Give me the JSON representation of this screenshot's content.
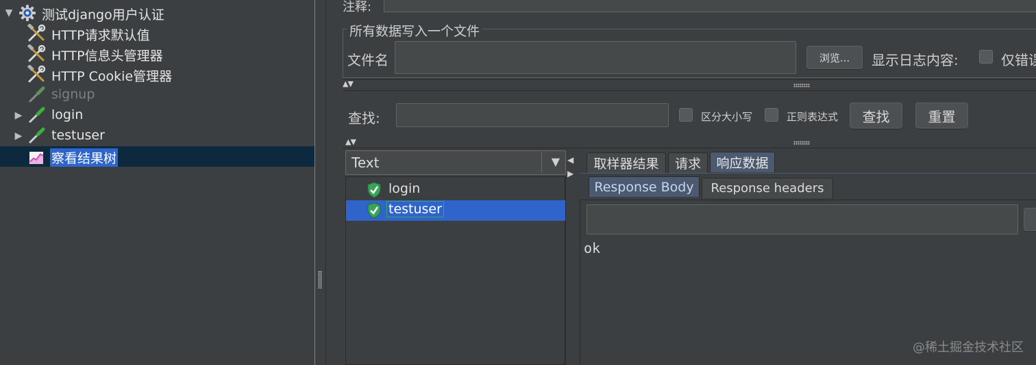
{
  "tree": {
    "items": [
      {
        "label": "测试django用户认证",
        "icon": "gear-icon",
        "expanded": true
      },
      {
        "label": "HTTP请求默认值",
        "icon": "wrench-hammer-icon"
      },
      {
        "label": "HTTP信息头管理器",
        "icon": "wrench-hammer-icon"
      },
      {
        "label": "HTTP Cookie管理器",
        "icon": "wrench-hammer-icon"
      },
      {
        "label": "signup",
        "icon": "pipette-icon",
        "disabled": true
      },
      {
        "label": "login",
        "icon": "pipette-icon",
        "collapsed": true
      },
      {
        "label": "testuser",
        "icon": "pipette-icon",
        "collapsed": true
      },
      {
        "label": "察看结果树",
        "icon": "chart-icon",
        "selected": true
      }
    ]
  },
  "header": {
    "comment_label": "注释:"
  },
  "file_section": {
    "title": "所有数据写入一个文件",
    "filename_label": "文件名",
    "filename_value": "",
    "browse_label": "浏览...",
    "log_display_label": "显示日志内容:",
    "errors_only_label": "仅错误"
  },
  "search": {
    "label": "查找:",
    "value": "",
    "case_sensitive_label": "区分大小写",
    "regex_label": "正则表达式",
    "find_button": "查找",
    "reset_button": "重置"
  },
  "results": {
    "renderer": "Text",
    "items": [
      {
        "label": "login",
        "status": "success"
      },
      {
        "label": "testuser",
        "status": "success",
        "selected": true
      }
    ]
  },
  "tabs": {
    "main": [
      "取样器结果",
      "请求",
      "响应数据"
    ],
    "active_main": "响应数据",
    "sub": [
      "Response Body",
      "Response headers"
    ],
    "active_sub": "Response Body"
  },
  "response": {
    "search_value": "",
    "body": "ok"
  },
  "watermark": "@稀土掘金技术社区",
  "colors": {
    "background": "#3c3f41",
    "selection": "#2f65ca",
    "tree_selected_row": "#0d293e",
    "active_tab": "#4b5a70",
    "success": "#3aa35a"
  }
}
